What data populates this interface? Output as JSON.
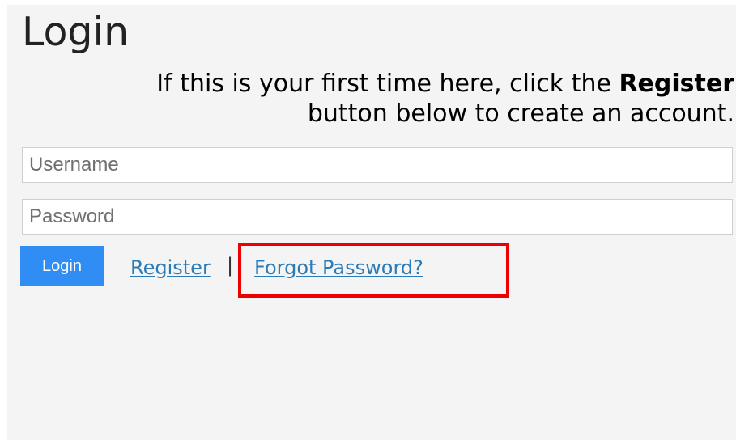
{
  "page": {
    "title": "Login"
  },
  "intro": {
    "text_before": "If this is your first time here, click the ",
    "text_bold": "Register",
    "text_after": " button below to create an account."
  },
  "form": {
    "username_placeholder": "Username",
    "password_placeholder": "Password",
    "login_label": "Login",
    "register_label": "Register",
    "separator": "|",
    "forgot_label": "Forgot Password?"
  },
  "colors": {
    "background": "#f4f4f4",
    "button": "#2f8df3",
    "link": "#2b7bb9",
    "highlight": "#ee0000"
  }
}
